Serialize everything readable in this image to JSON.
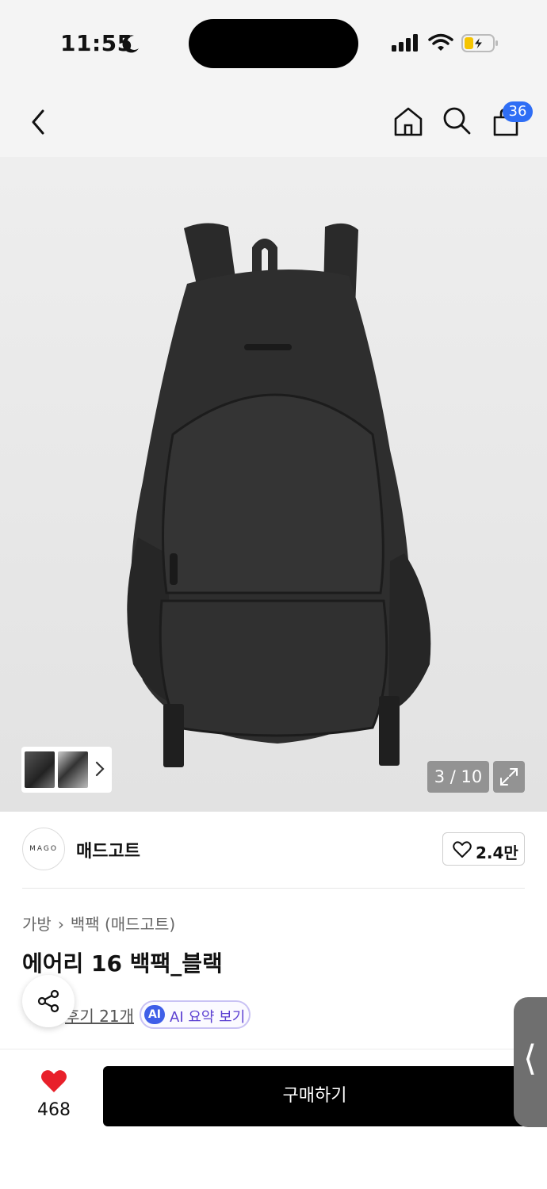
{
  "status": {
    "time": "11:55"
  },
  "header": {
    "cart_count": "36"
  },
  "gallery": {
    "counter": "3 / 10"
  },
  "brand": {
    "logo_text": "MAGO",
    "name": "매드고트",
    "likes": "2.4만"
  },
  "product": {
    "breadcrumb": [
      "가방",
      "백팩 (매드고트)"
    ],
    "title": "에어리 16 백팩_블랙",
    "reviews_label": "후기 21개",
    "ai_badge": "AI",
    "ai_summary_label": "AI 요약 보기"
  },
  "footer": {
    "wish_count": "468",
    "buy_label": "구매하기",
    "side_tab_glyph": "⟨"
  },
  "colors": {
    "accent_blue": "#2f6ef5",
    "heart_red": "#e8202a",
    "buy_bg": "#000000",
    "ai_purple": "#5b3fd1"
  },
  "icons": [
    "back-icon",
    "home-icon",
    "search-icon",
    "shopping-bag-icon",
    "expand-icon",
    "heart-outline-icon",
    "share-icon",
    "heart-filled-icon",
    "chevron-right-icon"
  ]
}
